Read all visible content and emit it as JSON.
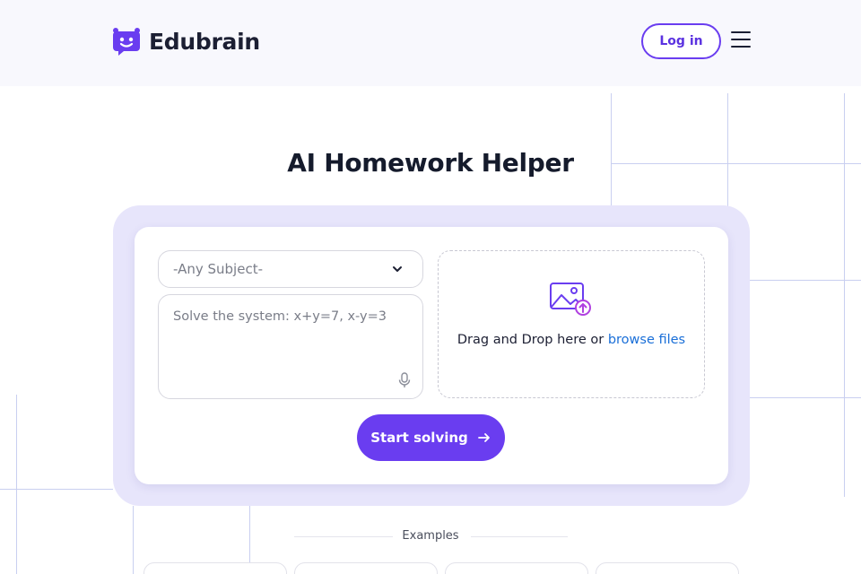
{
  "header": {
    "brand": "Edubrain",
    "login_label": "Log in"
  },
  "main": {
    "title": "AI Homework Helper",
    "subject_select": {
      "selected": "-Any Subject-"
    },
    "question_input": {
      "placeholder": "Solve the system: x+y=7, x-y=3"
    },
    "drop_zone": {
      "text": "Drag and Drop here or ",
      "browse_link": "browse files"
    },
    "submit_label": "Start solving",
    "examples_label": "Examples"
  },
  "colors": {
    "accent": "#6a3df0",
    "panel": "#e7e5fb",
    "link": "#1a6fd8",
    "grid": "#c9cff0"
  },
  "icons": [
    "logo-face-icon",
    "hamburger-menu-icon",
    "chevron-down-icon",
    "microphone-icon",
    "image-upload-icon",
    "arrow-right-icon"
  ]
}
